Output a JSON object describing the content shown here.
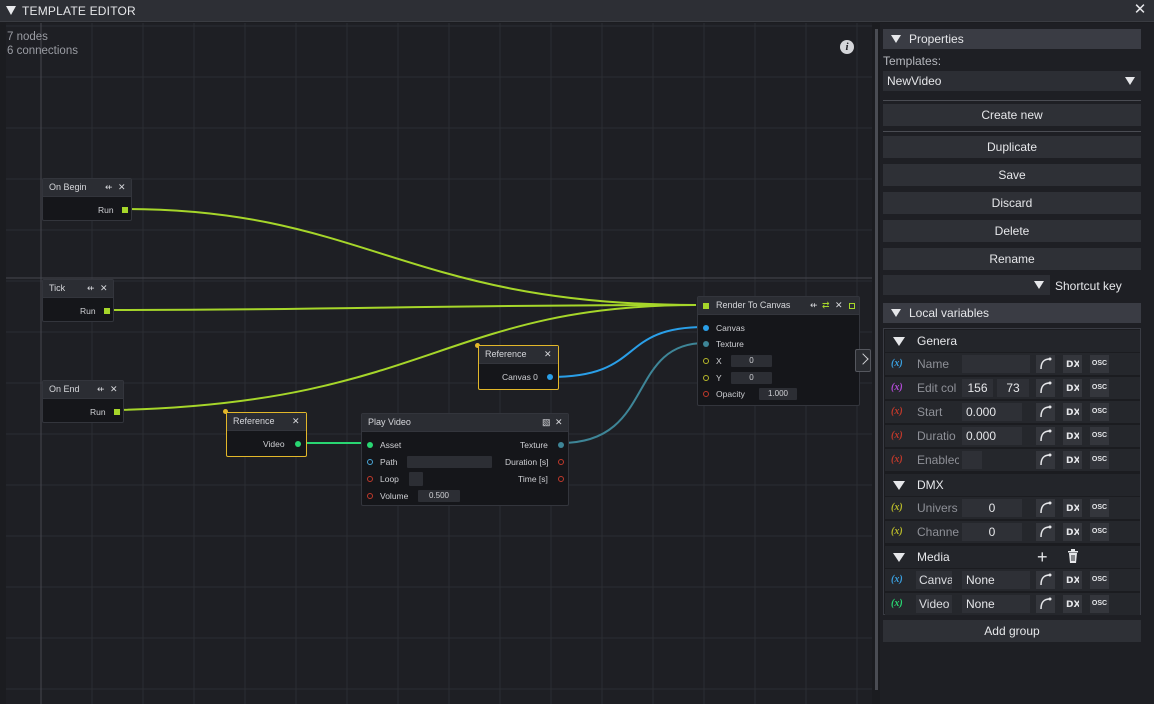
{
  "window": {
    "title": "TEMPLATE EDITOR",
    "close_glyph": "✕"
  },
  "graph": {
    "stats": {
      "nodes": "7 nodes",
      "connections": "6 connections"
    },
    "info_glyph": "i",
    "nodes": {
      "on_begin": {
        "title": "On Begin",
        "out": "Run"
      },
      "tick": {
        "title": "Tick",
        "out": "Run"
      },
      "on_end": {
        "title": "On End",
        "out": "Run"
      },
      "reference_video": {
        "title": "Reference",
        "out": "Video"
      },
      "reference_canvas": {
        "title": "Reference",
        "out": "Canvas 0"
      },
      "play_video": {
        "title": "Play Video",
        "inputs": [
          "Asset",
          "Path",
          "Loop",
          "Volume"
        ],
        "volume": "0.500",
        "outputs": [
          "Texture",
          "Duration [s]",
          "Time [s]"
        ]
      },
      "render_to_canvas": {
        "title": "Render To Canvas",
        "inputs": [
          "Canvas",
          "Texture",
          "X",
          "Y",
          "Opacity"
        ],
        "x": "0",
        "y": "0",
        "opacity": "1.000"
      }
    },
    "pin_colors": {
      "exec": "#a6d62a",
      "canvas": "#2a9fe8",
      "texture": "#3e8597",
      "video": "#29d672",
      "float": "#c0392b",
      "int": "#b7b82a",
      "path": "#4aa7d8"
    }
  },
  "properties": {
    "header": "Properties",
    "templates_label": "Templates:",
    "template_selected": "NewVideo",
    "buttons": {
      "create_new": "Create new",
      "duplicate": "Duplicate",
      "save": "Save",
      "discard": "Discard",
      "delete": "Delete",
      "rename": "Rename"
    },
    "shortcut_label": "Shortcut key"
  },
  "local_variables": {
    "header": "Local variables",
    "groups": [
      {
        "name": "Genera",
        "vars": [
          {
            "name": "Name",
            "color": "#3aa0e0"
          },
          {
            "name": "Edit col",
            "color": "#b24bd6",
            "v1": "156",
            "v2": "73"
          },
          {
            "name": "Start",
            "color": "#c0392b",
            "value": "0.000"
          },
          {
            "name": "Duratio",
            "color": "#c0392b",
            "value": "0.000"
          },
          {
            "name": "Enablec",
            "color": "#c0392b"
          }
        ]
      },
      {
        "name": "DMX",
        "vars": [
          {
            "name": "Univers",
            "color": "#b7b82a",
            "value": "0"
          },
          {
            "name": "Channe",
            "color": "#b7b82a",
            "value": "0"
          }
        ]
      },
      {
        "name": "Media",
        "vars": [
          {
            "name": "Canva",
            "color": "#3aa0e0",
            "value": "None"
          },
          {
            "name": "Video",
            "color": "#29d672",
            "value": "None"
          }
        ]
      }
    ],
    "var_glyph": "(x)",
    "osc_label": "OSC",
    "add_group": "Add group"
  }
}
